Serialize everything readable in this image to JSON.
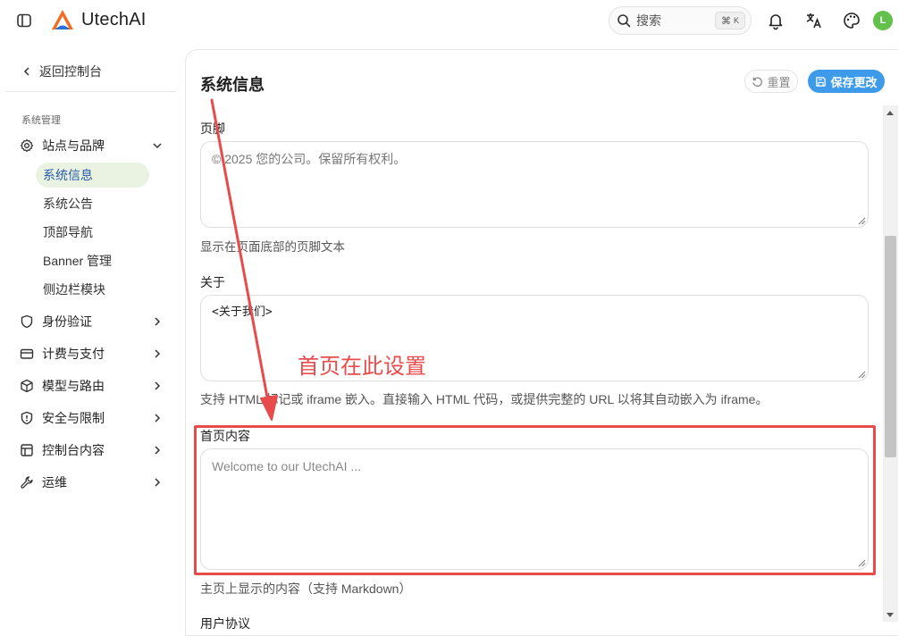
{
  "header": {
    "brand": "UtechAI",
    "search_label": "搜索",
    "search_shortcut_symbol": "⌘",
    "search_shortcut_key": "K",
    "avatar_initial": "L",
    "avatar_color": "#62c14b"
  },
  "sidebar": {
    "back_label": "返回控制台",
    "section_label": "系统管理",
    "groups": [
      {
        "label": "站点与品牌",
        "icon": "gear-icon",
        "expanded": true
      },
      {
        "label": "身份验证",
        "icon": "shield-icon"
      },
      {
        "label": "计费与支付",
        "icon": "credit-card-icon"
      },
      {
        "label": "模型与路由",
        "icon": "cube-icon"
      },
      {
        "label": "安全与限制",
        "icon": "shield-alert-icon"
      },
      {
        "label": "控制台内容",
        "icon": "layout-icon"
      },
      {
        "label": "运维",
        "icon": "wrench-icon"
      }
    ],
    "sub_items": [
      {
        "label": "系统信息",
        "active": true
      },
      {
        "label": "系统公告"
      },
      {
        "label": "顶部导航"
      },
      {
        "label": "Banner 管理"
      },
      {
        "label": "侧边栏模块"
      }
    ]
  },
  "main": {
    "title": "系统信息",
    "reset_label": "重置",
    "save_label": "保存更改",
    "accent_color": "#3d9be9",
    "fields": [
      {
        "label": "页脚",
        "value": "© 2025 您的公司。保留所有权利。",
        "help": "显示在页面底部的页脚文本"
      },
      {
        "label": "关于",
        "value": "<关于我们>",
        "help": "支持 HTML 标记或 iframe 嵌入。直接输入 HTML 代码，或提供完整的 URL 以将其自动嵌入为 iframe。"
      },
      {
        "label": "首页内容",
        "placeholder": "Welcome to our UtechAI ...",
        "help": "主页上显示的内容（支持 Markdown）"
      },
      {
        "label": "用户协议"
      }
    ]
  },
  "annotation": {
    "text": "首页在此设置",
    "color": "#e84b4b"
  }
}
